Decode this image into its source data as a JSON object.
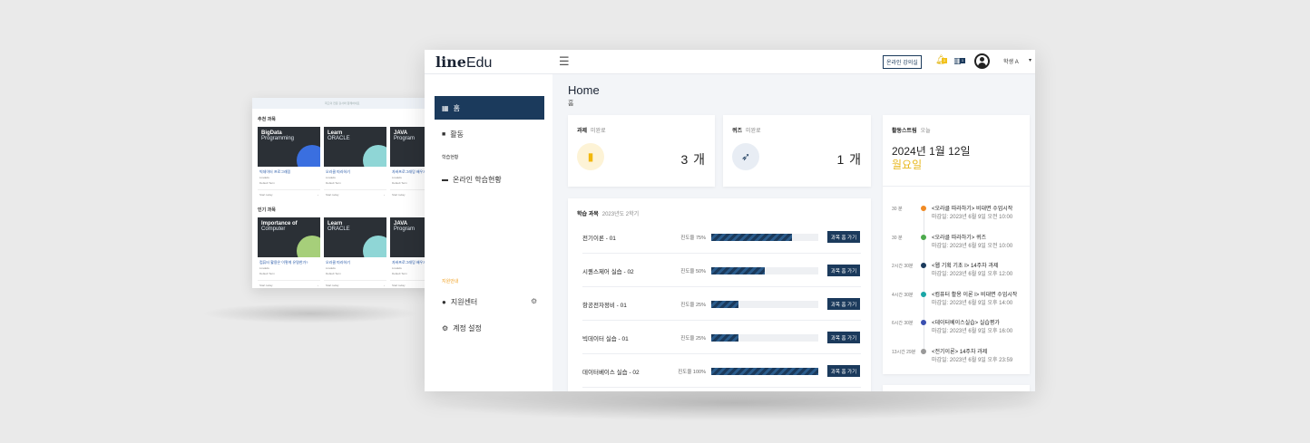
{
  "back_screen": {
    "top_text": "최고의 전문 강사와 함께하세요",
    "section1": "추천 과목",
    "section2": "인기 과목",
    "row1": [
      {
        "title1": "BigData",
        "title2": "Programming",
        "caption": "빅데이터 프로그래밍",
        "sub1": "LineEdu",
        "sub2": "Default Term",
        "foot": "Start today",
        "blob": "#3a6fe0"
      },
      {
        "title1": "Learn",
        "title2": "ORACLE",
        "caption": "오라클 따라하기",
        "sub1": "LineEdu",
        "sub2": "Default Term",
        "foot": "Start today",
        "blob": "#8fd6d6"
      },
      {
        "title1": "JAVA",
        "title2": "Program",
        "caption": "자바프로그래밍 배우기",
        "sub1": "LineEdu",
        "sub2": "Default Term",
        "foot": "Start today",
        "blob": "#a6cf7a"
      }
    ],
    "row2": [
      {
        "title1": "Importance of",
        "title2": "Computer",
        "caption": "컴퓨터 활용은 이렇게 유명한가?",
        "sub1": "LineEdu",
        "sub2": "Default Term",
        "foot": "Start today",
        "blob": "#a6cf7a"
      },
      {
        "title1": "Learn",
        "title2": "ORACLE",
        "caption": "오라클 따라하기",
        "sub1": "LineEdu",
        "sub2": "Default Term",
        "foot": "Start today",
        "blob": "#8fd6d6"
      },
      {
        "title1": "JAVA",
        "title2": "Program",
        "caption": "자바프로그래밍 배우기",
        "sub1": "LineEdu",
        "sub2": "Default Term",
        "foot": "Start today",
        "blob": "#a6cf7a"
      }
    ]
  },
  "header": {
    "logo_bold": "line",
    "logo_light": "Edu",
    "online_lecture_btn": "온라인 강의실",
    "bell_badge": "1",
    "book_badge": "1",
    "user_name": "학생 A"
  },
  "sidebar": {
    "home": "홈",
    "activity": "활동",
    "study_heading": "학습현황",
    "online_status": "온라인 학습현황",
    "support_heading": "지원안내",
    "support_center": "지원센터",
    "account_settings": "계정 설정"
  },
  "page": {
    "title": "Home",
    "subtitle": "홈"
  },
  "assignment_card": {
    "label": "과제",
    "sublabel": "미완료",
    "count": "3 개"
  },
  "quiz_card": {
    "label": "퀴즈",
    "sublabel": "미완료",
    "count": "1 개"
  },
  "courses": {
    "label": "학습 과목",
    "term": "2023년도 2학기",
    "progress_label": "진도율",
    "button_label": "과목 홈 가기",
    "items": [
      {
        "name": "전기이론 - 01",
        "progress": 75
      },
      {
        "name": "시퀀스제어 실습 - 02",
        "progress": 50
      },
      {
        "name": "항공전자정비 - 01",
        "progress": 25
      },
      {
        "name": "빅데이터 실습 - 01",
        "progress": 25
      },
      {
        "name": "데이터베이스 실습 - 02",
        "progress": 100
      }
    ]
  },
  "stream": {
    "label": "활동스트림",
    "sublabel": "오늘",
    "date": "2024년 1월 12일",
    "weekday": "월요일",
    "items": [
      {
        "time": "30 분",
        "title": "<오라클 따라하기> 비대면 수업시작",
        "due": "마감일: 2023년 6월 9일 오전 10:00",
        "color": "#f08a24"
      },
      {
        "time": "30 분",
        "title": "<오라클 따라하기> 퀴즈",
        "due": "마감일: 2023년 6월 9일 오전 10:00",
        "color": "#4caa4c"
      },
      {
        "time": "2시간 30분",
        "title": "<웹 기획 기초 I> 14주차 과제",
        "due": "마감일: 2023년 6월 9일 오후 12:00",
        "color": "#1b3a5c"
      },
      {
        "time": "4시간 30분",
        "title": "<컴퓨터 활용 이론 I> 비대면 수업시작",
        "due": "마감일: 2023년 6월 9일 오후 14:00",
        "color": "#1aa6a6"
      },
      {
        "time": "6시간 30분",
        "title": "<데이터베이스실습> 실습평가",
        "due": "마감일: 2023년 6월 9일 오후 16:00",
        "color": "#3a4fb0"
      },
      {
        "time": "13시간 29분",
        "title": "<전기이론> 14주차 과제",
        "due": "마감일: 2023년 6월 9일 오후 23:59",
        "color": "#999999"
      }
    ]
  }
}
